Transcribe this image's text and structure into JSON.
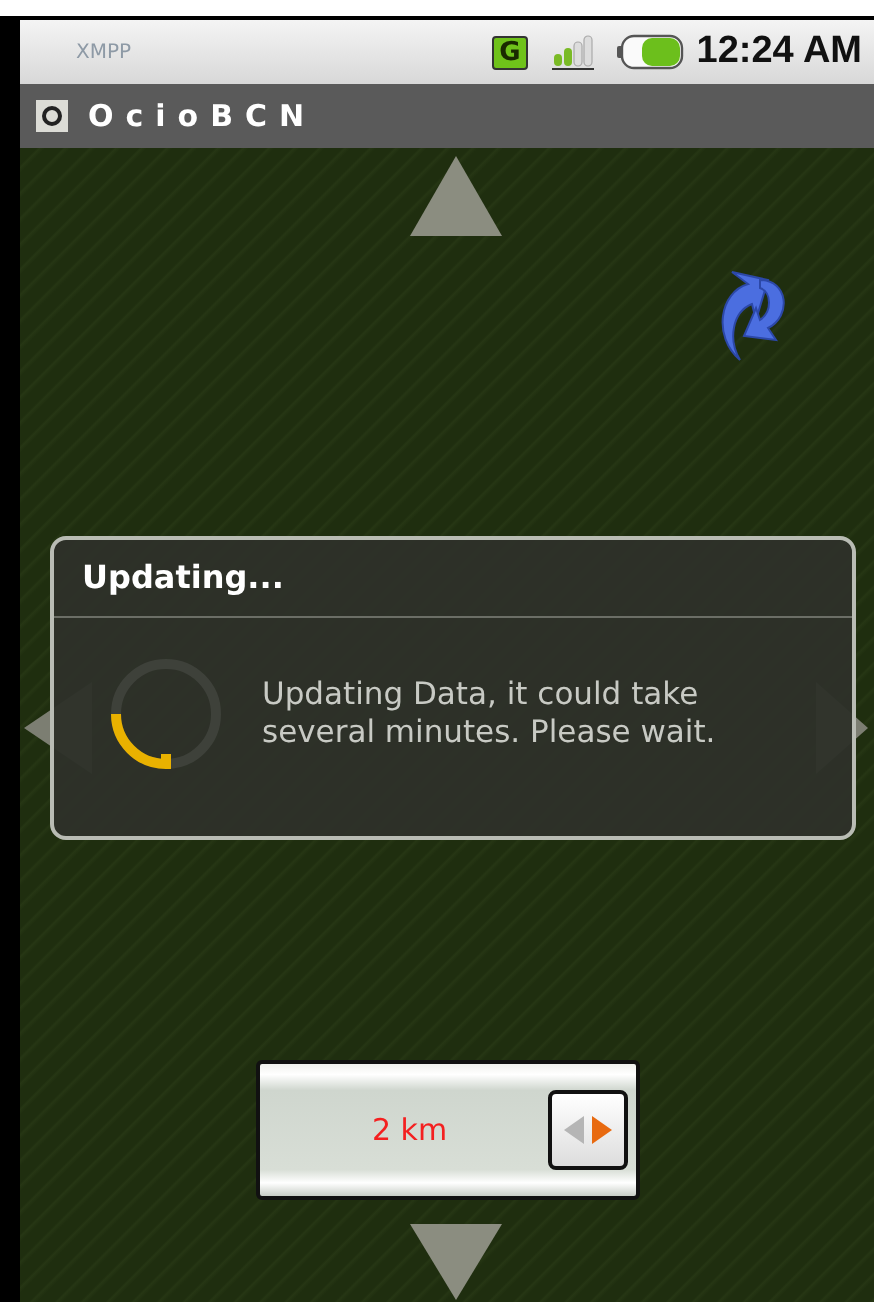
{
  "status_bar": {
    "notification": "XMPP",
    "network_badge": "G",
    "time": "12:24 AM"
  },
  "title_bar": {
    "title": "OcioBCN"
  },
  "dialog": {
    "title": "Updating...",
    "message": "Updating Data, it could take several minutes. Please wait."
  },
  "distance_selector": {
    "value": "2 km"
  }
}
